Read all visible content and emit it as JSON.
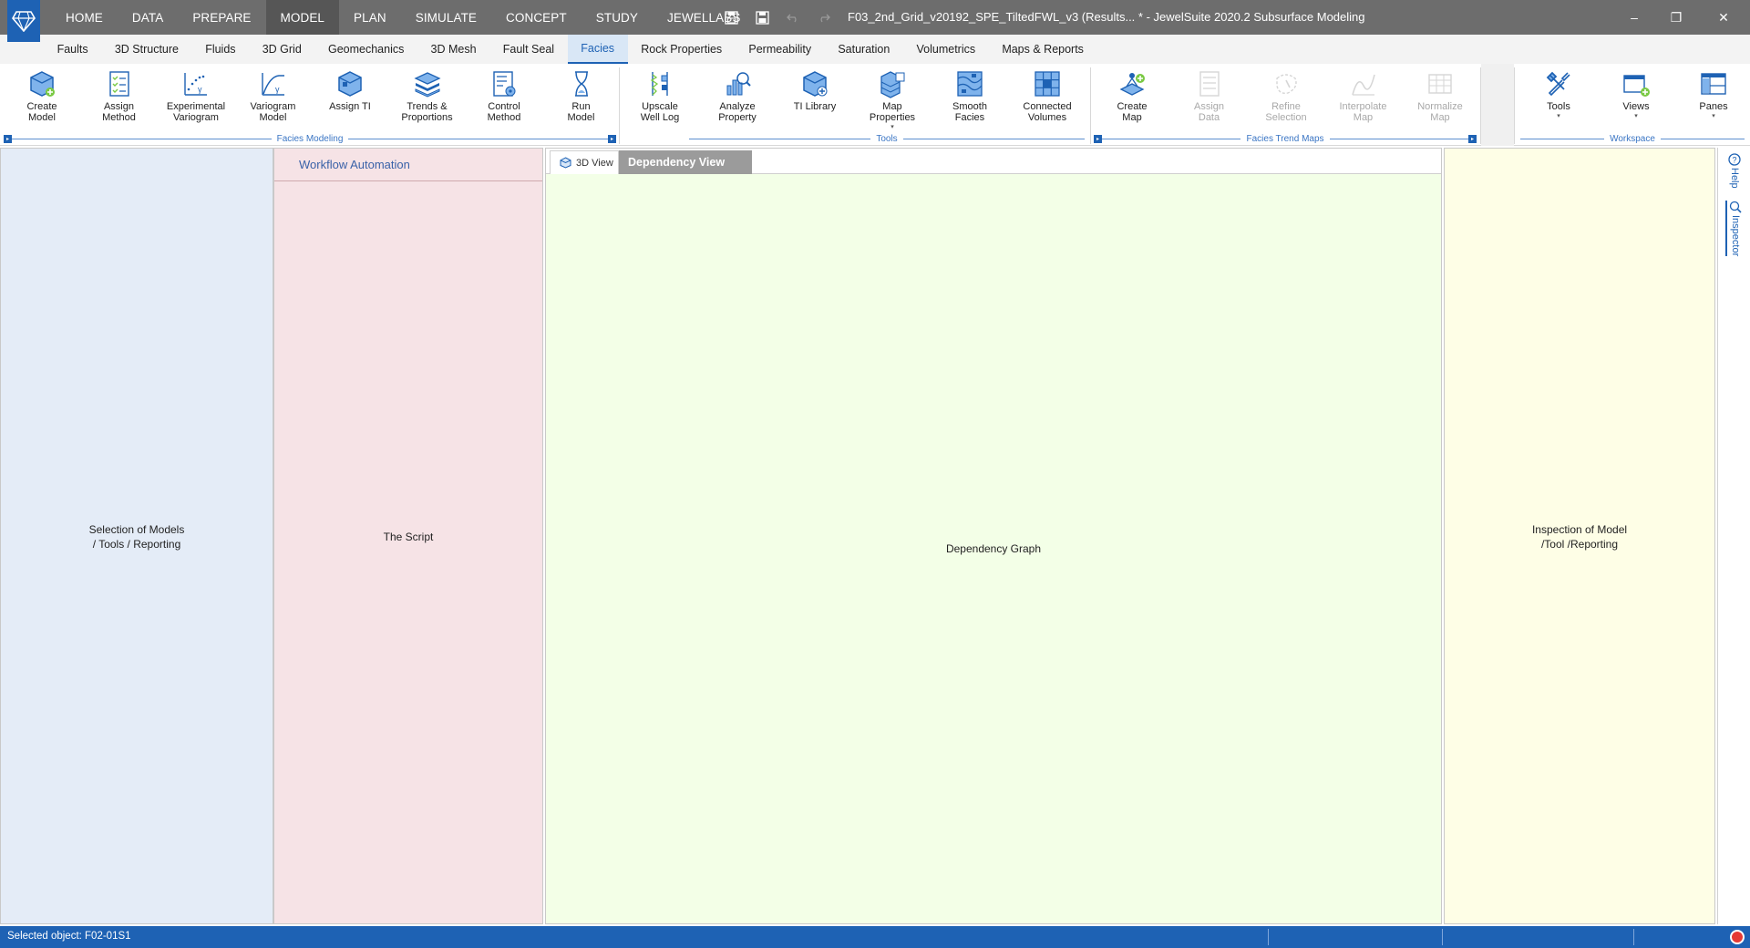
{
  "titlebar": {
    "menu": [
      "HOME",
      "DATA",
      "PREPARE",
      "MODEL",
      "PLAN",
      "SIMULATE",
      "CONCEPT",
      "STUDY",
      "JEWELLABS"
    ],
    "active_menu": "MODEL",
    "window_title": "F03_2nd_Grid_v20192_SPE_TiltedFWL_v3 (Results... * - JewelSuite 2020.2 Subsurface Modeling",
    "controls": {
      "minimize": "–",
      "restore": "❐",
      "close": "✕"
    }
  },
  "subtabs": {
    "items": [
      "Faults",
      "3D Structure",
      "Fluids",
      "3D Grid",
      "Geomechanics",
      "3D Mesh",
      "Fault Seal",
      "Facies",
      "Rock Properties",
      "Permeability",
      "Saturation",
      "Volumetrics",
      "Maps & Reports"
    ],
    "active": "Facies"
  },
  "ribbon": {
    "groups": {
      "facies_modeling": {
        "caption": "Facies Modeling",
        "buttons": [
          {
            "label": "Create\nModel",
            "icon": "create-model-icon"
          },
          {
            "label": "Assign\nMethod",
            "icon": "assign-method-icon"
          },
          {
            "label": "Experimental\nVariogram",
            "icon": "experimental-variogram-icon"
          },
          {
            "label": "Variogram\nModel",
            "icon": "variogram-model-icon"
          },
          {
            "label": "Assign TI",
            "icon": "assign-ti-icon"
          },
          {
            "label": "Trends &\nProportions",
            "icon": "trends-proportions-icon"
          },
          {
            "label": "Control\nMethod",
            "icon": "control-method-icon"
          },
          {
            "label": "Run\nModel",
            "icon": "run-model-icon"
          }
        ]
      },
      "tools": {
        "caption": "Tools",
        "buttons": [
          {
            "label": "Upscale\nWell Log",
            "icon": "upscale-well-log-icon"
          },
          {
            "label": "Analyze\nProperty",
            "icon": "analyze-property-icon"
          },
          {
            "label": "TI Library",
            "icon": "ti-library-icon"
          },
          {
            "label": "Map\nProperties",
            "icon": "map-properties-icon",
            "caret": "▾"
          },
          {
            "label": "Smooth\nFacies",
            "icon": "smooth-facies-icon"
          },
          {
            "label": "Connected\nVolumes",
            "icon": "connected-volumes-icon"
          }
        ]
      },
      "facies_trend_maps": {
        "caption": "Facies Trend Maps",
        "buttons": [
          {
            "label": "Create\nMap",
            "icon": "create-map-icon",
            "disabled": false
          },
          {
            "label": "Assign\nData",
            "icon": "assign-data-icon",
            "disabled": true
          },
          {
            "label": "Refine\nSelection",
            "icon": "refine-selection-icon",
            "disabled": true
          },
          {
            "label": "Interpolate\nMap",
            "icon": "interpolate-map-icon",
            "disabled": true
          },
          {
            "label": "Normalize\nMap",
            "icon": "normalize-map-icon",
            "disabled": true
          }
        ]
      },
      "workspace": {
        "caption": "Workspace",
        "buttons": [
          {
            "label": "Tools",
            "icon": "tools-icon",
            "caret": "▾"
          },
          {
            "label": "Views",
            "icon": "views-icon",
            "caret": "▾"
          },
          {
            "label": "Panes",
            "icon": "panes-icon",
            "caret": "▾"
          }
        ]
      }
    }
  },
  "panes": {
    "left": "Selection of Models\n/ Tools / Reporting",
    "script_header": "Workflow Automation",
    "script": "The Script",
    "view_tabs": {
      "three_d": "3D View",
      "dependency": "Dependency View"
    },
    "center": "Dependency Graph",
    "right": "Inspection of Model\n/Tool /Reporting"
  },
  "side_tabs": {
    "help": "Help",
    "inspector": "Inspector"
  },
  "status": {
    "text": "Selected object: F02-01S1"
  },
  "colors": {
    "titlebar": "#6d6d6d",
    "accent": "#1e62b4",
    "pane_left": "#e4ecf7",
    "pane_script": "#f6e3e6",
    "pane_center": "#f3ffe7",
    "pane_right": "#fefee6"
  }
}
